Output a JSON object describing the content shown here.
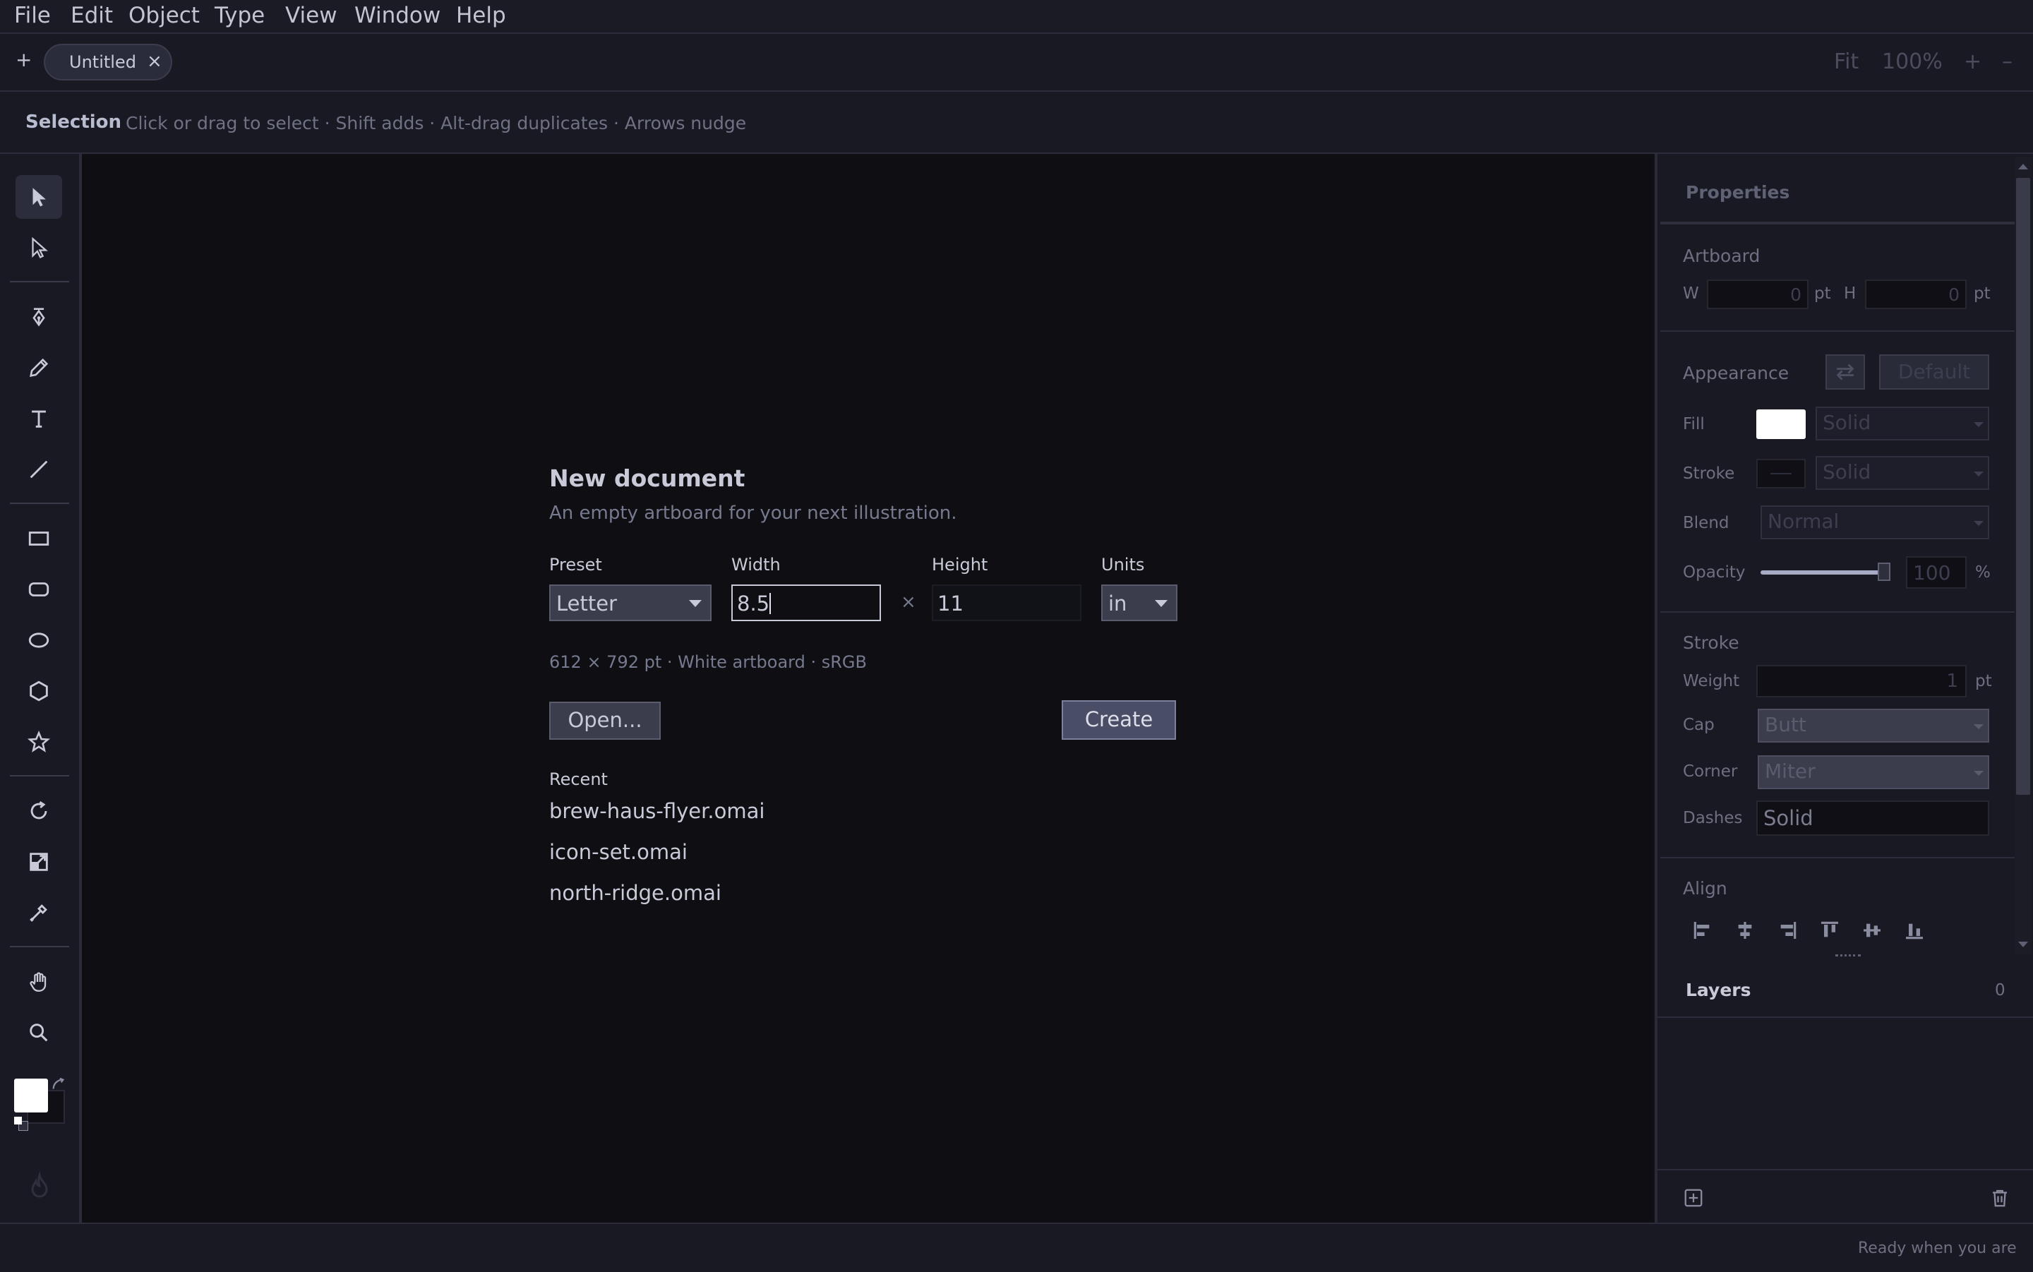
{
  "menu": [
    "File",
    "Edit",
    "Object",
    "Type",
    "View",
    "Window",
    "Help"
  ],
  "tabs": {
    "add_label": "+",
    "active_title": "Untitled",
    "close_label": "×"
  },
  "zoom": {
    "fit_label": "Fit",
    "level": "100%",
    "zoom_in": "+",
    "zoom_out": "–"
  },
  "hint": {
    "tool_name": "Selection",
    "text": "Click or drag to select · Shift adds · Alt-drag duplicates · Arrows nudge"
  },
  "tools": [
    "selection-tool",
    "direct-selection-tool",
    "pen-tool",
    "pencil-tool",
    "type-tool",
    "line-tool",
    "rectangle-tool",
    "rounded-rectangle-tool",
    "ellipse-tool",
    "polygon-tool",
    "star-tool",
    "rotate-tool",
    "scale-tool",
    "eyedropper-tool",
    "hand-tool",
    "zoom-tool"
  ],
  "colors": {
    "fill": "#ffffff",
    "stroke": "#0f0f15",
    "accent": "#4a4d66",
    "panel_bg": "#191923"
  },
  "dialog": {
    "title": "New document",
    "subtitle": "An empty artboard for your next illustration.",
    "preset_label": "Preset",
    "preset_value": "Letter",
    "width_label": "Width",
    "width_value": "8.5",
    "times": "×",
    "height_label": "Height",
    "height_value": "11",
    "units_label": "Units",
    "units_value": "in",
    "summary": "612 × 792 pt · White artboard · sRGB",
    "open_label": "Open...",
    "create_label": "Create",
    "recent_label": "Recent",
    "recent": [
      "brew-haus-flyer.omai",
      "icon-set.omai",
      "north-ridge.omai"
    ]
  },
  "properties": {
    "title": "Properties",
    "artboard": {
      "label": "Artboard",
      "w_label": "W",
      "w_value": "0",
      "w_unit": "pt",
      "h_label": "H",
      "h_value": "0",
      "h_unit": "pt"
    },
    "appearance": {
      "label": "Appearance",
      "swap_icon": "swap-icon",
      "default_label": "Default",
      "fill_label": "Fill",
      "fill_mode": "Solid",
      "stroke_label": "Stroke",
      "stroke_mode": "Solid",
      "blend_label": "Blend",
      "blend_value": "Normal",
      "opacity_label": "Opacity",
      "opacity_value": "100",
      "opacity_unit": "%",
      "opacity_level": 1.0
    },
    "stroke": {
      "label": "Stroke",
      "weight_label": "Weight",
      "weight_value": "1",
      "weight_unit": "pt",
      "cap_label": "Cap",
      "cap_value": "Butt",
      "corner_label": "Corner",
      "corner_value": "Miter",
      "dashes_label": "Dashes",
      "dashes_value": "Solid"
    },
    "align": {
      "label": "Align",
      "icons": [
        "align-left-icon",
        "align-hcenter-icon",
        "align-right-icon",
        "align-top-icon",
        "align-vcenter-icon",
        "align-bottom-icon"
      ]
    }
  },
  "layers": {
    "label": "Layers",
    "count": "0"
  },
  "status": {
    "text": "Ready when you are"
  }
}
